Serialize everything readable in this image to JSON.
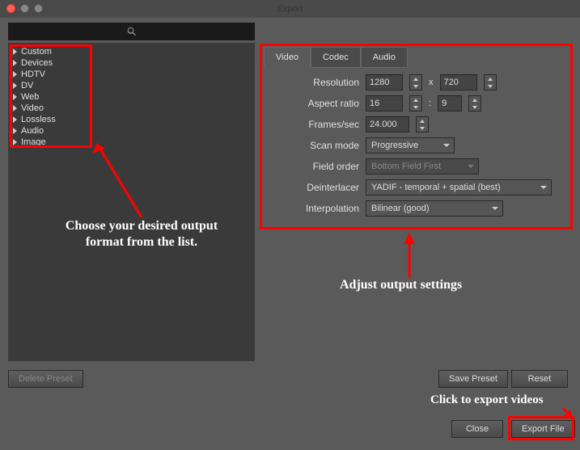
{
  "title": "Export",
  "sidebar": {
    "items": [
      {
        "label": "Custom"
      },
      {
        "label": "Devices"
      },
      {
        "label": "HDTV"
      },
      {
        "label": "DV"
      },
      {
        "label": "Web"
      },
      {
        "label": "Video"
      },
      {
        "label": "Lossless"
      },
      {
        "label": "Audio"
      },
      {
        "label": "Image"
      }
    ]
  },
  "tabs": [
    {
      "label": "Video"
    },
    {
      "label": "Codec"
    },
    {
      "label": "Audio"
    }
  ],
  "settings": {
    "resolution_label": "Resolution",
    "resolution_w": "1280",
    "resolution_x": "x",
    "resolution_h": "720",
    "aspect_label": "Aspect ratio",
    "aspect_w": "16",
    "aspect_sep": ":",
    "aspect_h": "9",
    "fps_label": "Frames/sec",
    "fps_value": "24.000",
    "scan_label": "Scan mode",
    "scan_value": "Progressive",
    "field_label": "Field order",
    "field_value": "Bottom Field First",
    "deint_label": "Deinterlacer",
    "deint_value": "YADIF - temporal + spatial (best)",
    "interp_label": "Interpolation",
    "interp_value": "Bilinear (good)"
  },
  "buttons": {
    "delete_preset": "Delete Preset",
    "save_preset": "Save Preset",
    "reset": "Reset",
    "close": "Close",
    "export_file": "Export File"
  },
  "annotations": {
    "left": "Choose your desired output format from the list.",
    "right": "Adjust output settings",
    "export": "Click to export videos"
  }
}
